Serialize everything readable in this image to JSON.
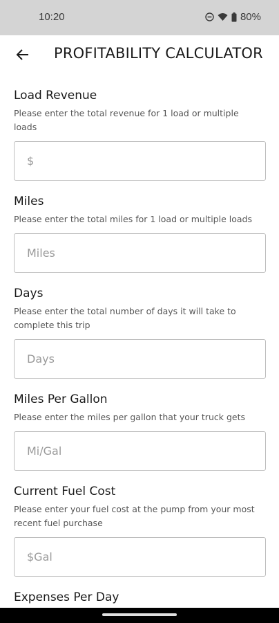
{
  "status_bar": {
    "time": "10:20",
    "battery": "80%",
    "icons": [
      "do-not-disturb-icon",
      "wifi-icon",
      "battery-icon"
    ]
  },
  "header": {
    "back_icon": "arrow-left-icon",
    "title": "PROFITABILITY CALCULATOR"
  },
  "form": {
    "fields": [
      {
        "label": "Load Revenue",
        "help": "Please enter the total revenue for 1 load or multiple loads",
        "placeholder": "$",
        "value": ""
      },
      {
        "label": "Miles",
        "help": "Please enter the total miles for 1 load or multiple loads",
        "placeholder": "Miles",
        "value": ""
      },
      {
        "label": "Days",
        "help": "Please enter the total number of days it will take to complete this trip",
        "placeholder": "Days",
        "value": ""
      },
      {
        "label": "Miles Per Gallon",
        "help": "Please enter the miles per gallon that your truck gets",
        "placeholder": "Mi/Gal",
        "value": ""
      },
      {
        "label": "Current Fuel Cost",
        "help": "Please enter your fuel cost at the pump from your most recent fuel purchase",
        "placeholder": "$Gal",
        "value": ""
      },
      {
        "label": "Expenses Per Day"
      }
    ]
  },
  "colors": {
    "status_bar_bg": "#d4d4d4",
    "input_border": "#bdbdbd",
    "placeholder": "#9a9a9a",
    "text": "#1a1a1a"
  }
}
